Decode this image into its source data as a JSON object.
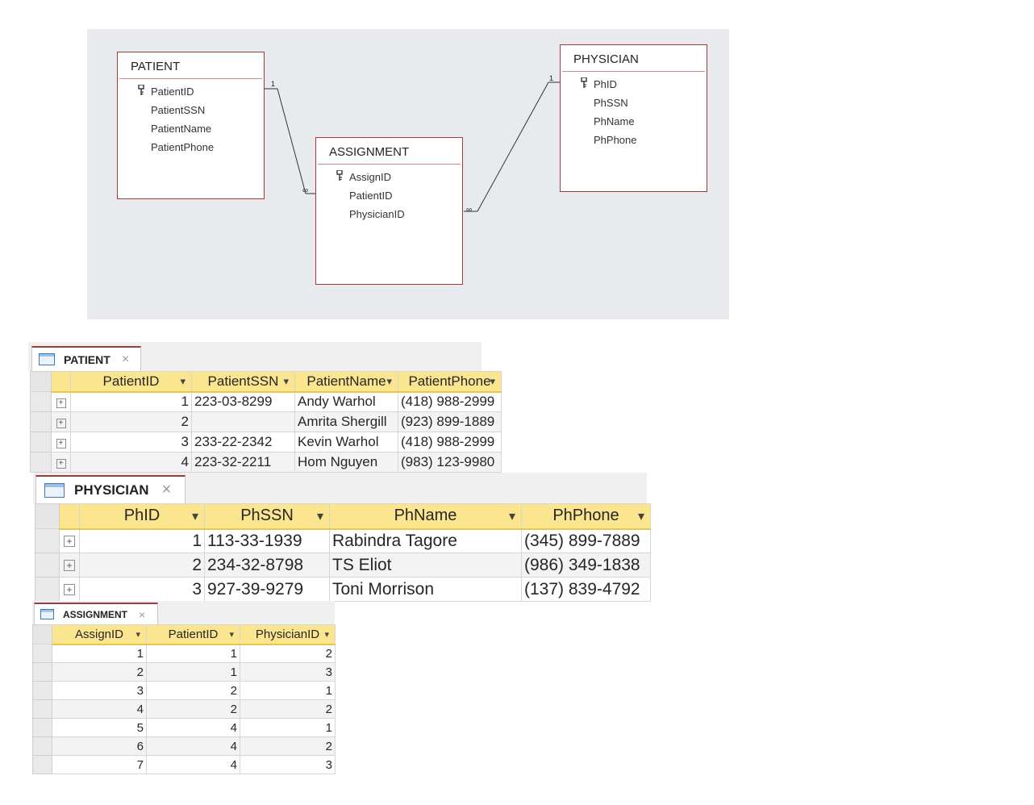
{
  "relationships": {
    "patient": {
      "name": "PATIENT",
      "fields": [
        {
          "name": "PatientID",
          "key": true
        },
        {
          "name": "PatientSSN",
          "key": false
        },
        {
          "name": "PatientName",
          "key": false
        },
        {
          "name": "PatientPhone",
          "key": false
        }
      ]
    },
    "assignment": {
      "name": "ASSIGNMENT",
      "fields": [
        {
          "name": "AssignID",
          "key": true
        },
        {
          "name": "PatientID",
          "key": false
        },
        {
          "name": "PhysicianID",
          "key": false
        }
      ]
    },
    "physician": {
      "name": "PHYSICIAN",
      "fields": [
        {
          "name": "PhID",
          "key": true
        },
        {
          "name": "PhSSN",
          "key": false
        },
        {
          "name": "PhName",
          "key": false
        },
        {
          "name": "PhPhone",
          "key": false
        }
      ]
    },
    "one_symbol": "1",
    "many_symbol": "∞"
  },
  "patient_table": {
    "tab_title": "PATIENT",
    "columns": [
      "PatientID",
      "PatientSSN",
      "PatientName",
      "PatientPhone"
    ],
    "rows": [
      [
        "1",
        "223-03-8299",
        "Andy Warhol",
        "(418) 988-2999"
      ],
      [
        "2",
        "",
        "Amrita Shergill",
        "(923) 899-1889"
      ],
      [
        "3",
        "233-22-2342",
        "Kevin Warhol",
        "(418) 988-2999"
      ],
      [
        "4",
        "223-32-2211",
        "Hom Nguyen",
        "(983) 123-9980"
      ]
    ]
  },
  "physician_table": {
    "tab_title": "PHYSICIAN",
    "columns": [
      "PhID",
      "PhSSN",
      "PhName",
      "PhPhone"
    ],
    "rows": [
      [
        "1",
        "113-33-1939",
        "Rabindra Tagore",
        "(345) 899-7889"
      ],
      [
        "2",
        "234-32-8798",
        "TS Eliot",
        "(986) 349-1838"
      ],
      [
        "3",
        "927-39-9279",
        "Toni Morrison",
        "(137) 839-4792"
      ]
    ]
  },
  "assignment_table": {
    "tab_title": "ASSIGNMENT",
    "columns": [
      "AssignID",
      "PatientID",
      "PhysicianID"
    ],
    "rows": [
      [
        "1",
        "1",
        "2"
      ],
      [
        "2",
        "1",
        "3"
      ],
      [
        "3",
        "2",
        "1"
      ],
      [
        "4",
        "2",
        "2"
      ],
      [
        "5",
        "4",
        "1"
      ],
      [
        "6",
        "4",
        "2"
      ],
      [
        "7",
        "4",
        "3"
      ]
    ]
  },
  "glyphs": {
    "close": "×",
    "dropdown": "▾",
    "expand": "+"
  }
}
